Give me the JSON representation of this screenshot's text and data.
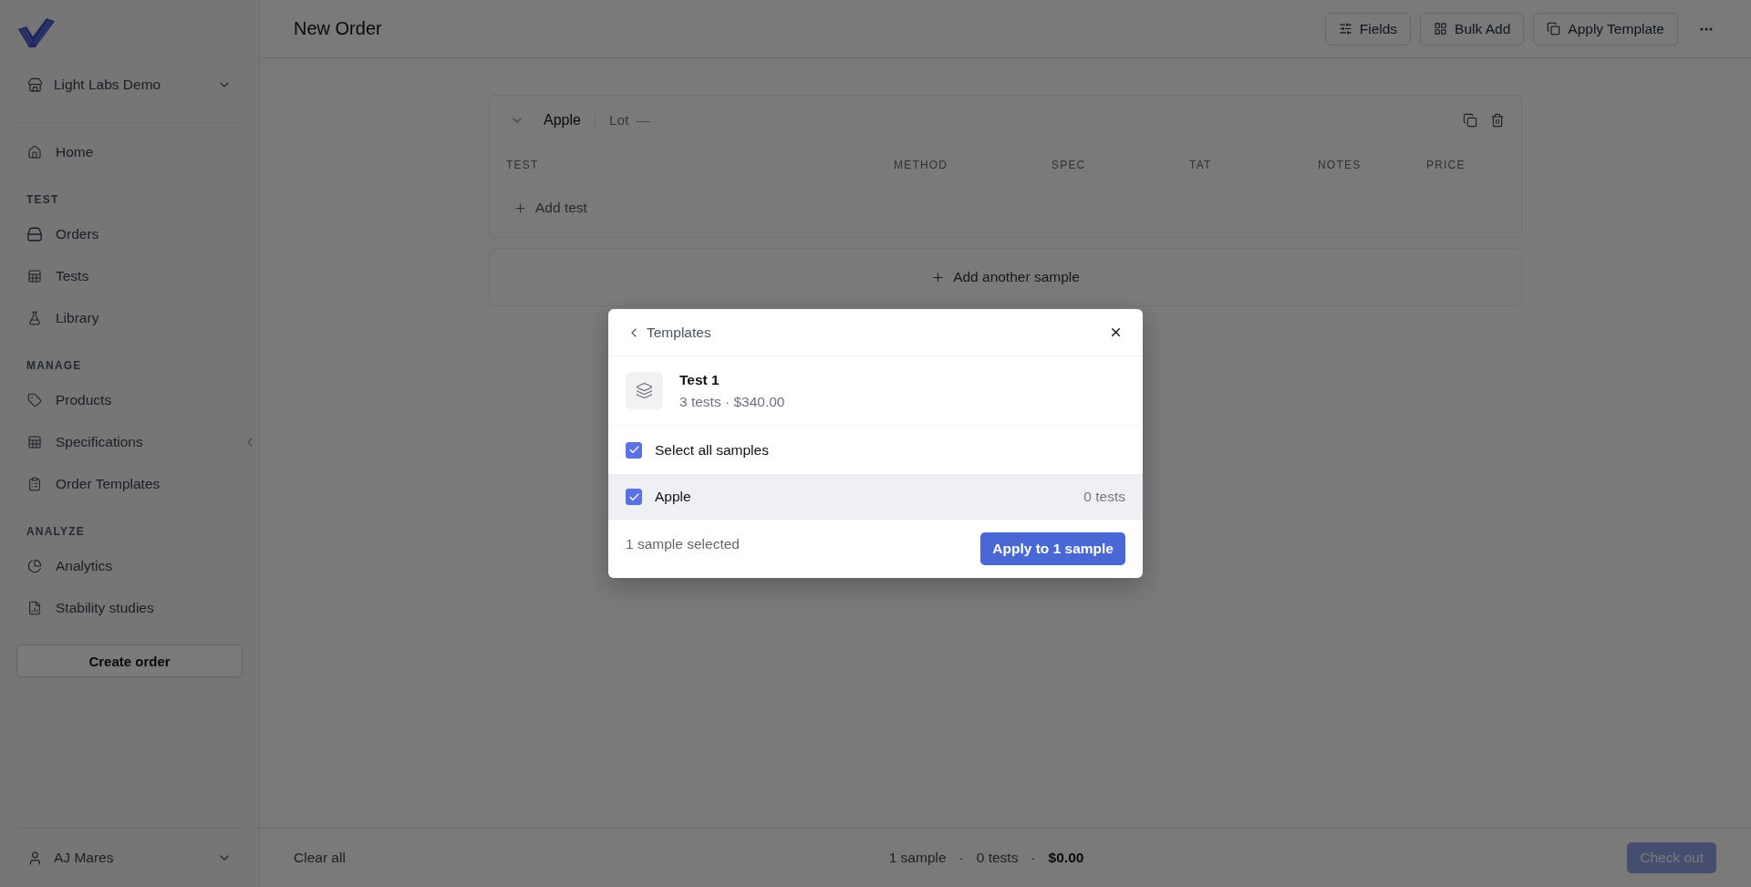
{
  "sidebar": {
    "workspace": "Light Labs Demo",
    "sections": [
      {
        "items": [
          {
            "label": "Home",
            "selected": false
          }
        ]
      },
      {
        "heading": "TEST",
        "items": [
          {
            "label": "Orders",
            "selected": false
          },
          {
            "label": "Tests",
            "selected": false
          },
          {
            "label": "Library",
            "selected": false
          }
        ]
      },
      {
        "heading": "MANAGE",
        "items": [
          {
            "label": "Products",
            "selected": false
          },
          {
            "label": "Specifications",
            "selected": false
          },
          {
            "label": "Order Templates",
            "selected": false
          }
        ]
      },
      {
        "heading": "ANALYZE",
        "items": [
          {
            "label": "Analytics",
            "selected": false
          },
          {
            "label": "Stability studies",
            "selected": false
          }
        ]
      }
    ],
    "create_button": "Create order",
    "user": "AJ Mares"
  },
  "header": {
    "title": "New Order",
    "actions": [
      {
        "label": "Fields"
      },
      {
        "label": "Bulk Add"
      },
      {
        "label": "Apply Template"
      }
    ]
  },
  "samples": [
    {
      "name": "Apple",
      "lot_label": "Lot",
      "lot_value": "—",
      "expanded": true,
      "columns": [
        "TEST",
        "METHOD",
        "SPEC",
        "TAT",
        "NOTES",
        "PRICE"
      ],
      "add_test": "Add test"
    }
  ],
  "add_sample": "Add another sample",
  "footer": {
    "clear": "Clear all",
    "summary": [
      {
        "kind": "count",
        "text": "1 sample"
      },
      {
        "kind": "separator",
        "text": "·"
      },
      {
        "kind": "count",
        "text": "0 tests"
      },
      {
        "kind": "separator",
        "text": "·"
      },
      {
        "kind": "total",
        "text": "$0.00"
      }
    ],
    "checkout": {
      "label": "Check out",
      "disabled": true
    }
  },
  "modal": {
    "back": "Templates",
    "template": {
      "name": "Test 1",
      "meta": "3 tests · $340.00"
    },
    "select_all": {
      "label": "Select all samples",
      "checked": true
    },
    "samples": [
      {
        "name": "Apple",
        "count": "0 tests",
        "checked": true,
        "hovered": true
      }
    ],
    "footer": {
      "status": "1 sample selected",
      "apply": "Apply to 1 sample"
    }
  }
}
